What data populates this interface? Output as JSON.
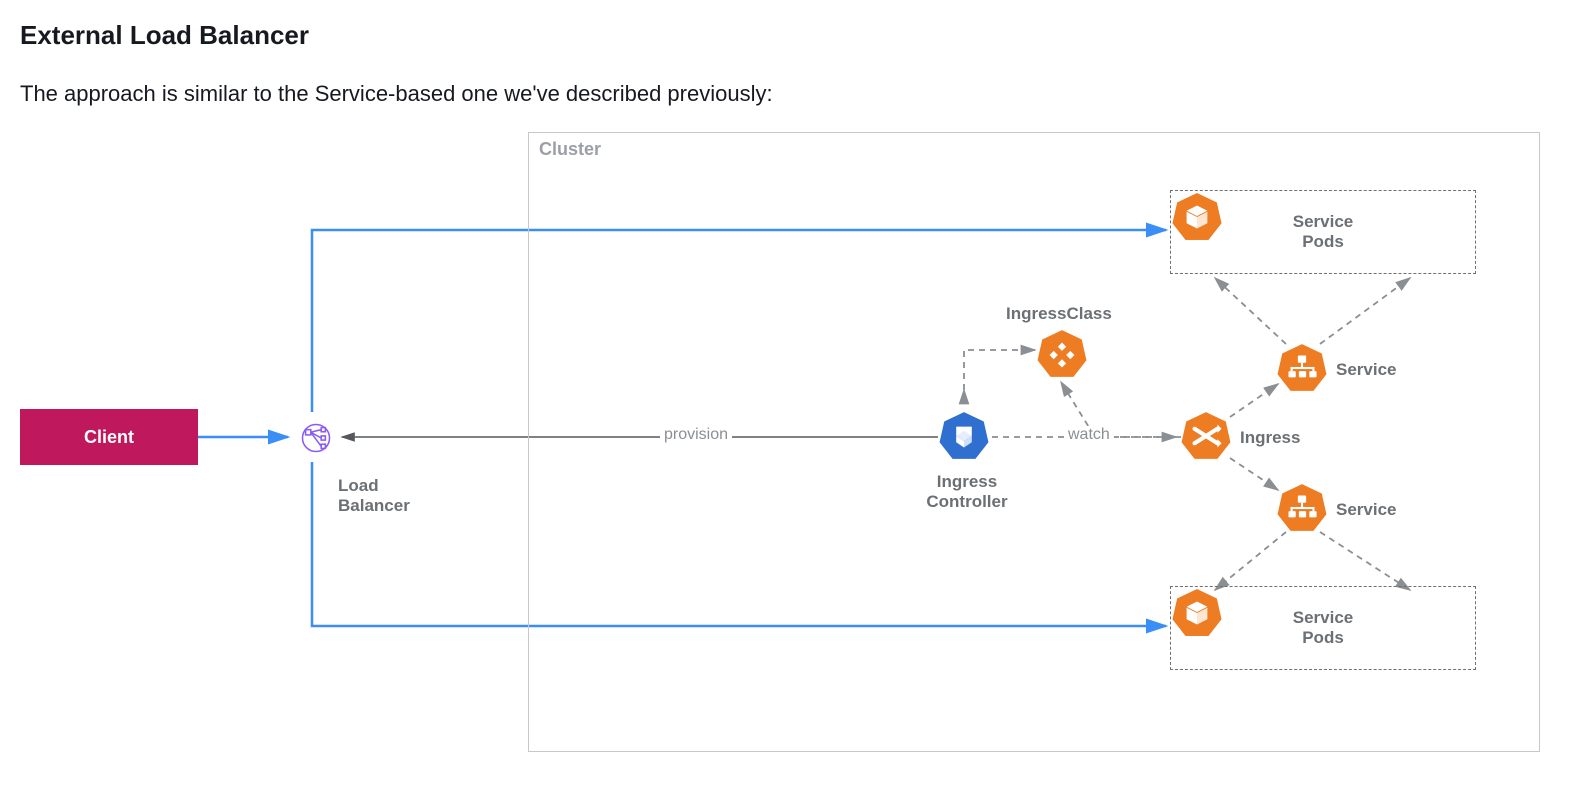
{
  "heading": "External Load Balancer",
  "intro": "The approach is similar to the Service-based one we've described previously:",
  "diagram": {
    "cluster_label": "Cluster",
    "client": "Client",
    "load_balancer": "Load\nBalancer",
    "ingress_controller": "Ingress\nController",
    "ingress_class": "IngressClass",
    "ingress": "Ingress",
    "service_top": "Service",
    "service_bottom": "Service",
    "service_pods_top": "Service\nPods",
    "service_pods_bottom": "Service\nPods",
    "edge_provision": "provision",
    "edge_watch": "watch",
    "colors": {
      "blue_arrow": "#3a8ef6",
      "orange": "#ed7c23",
      "k8s_blue": "#2f6fd0",
      "purple": "#8a5cf6",
      "client_bg": "#c0185c",
      "grey": "#8a8f94"
    }
  }
}
